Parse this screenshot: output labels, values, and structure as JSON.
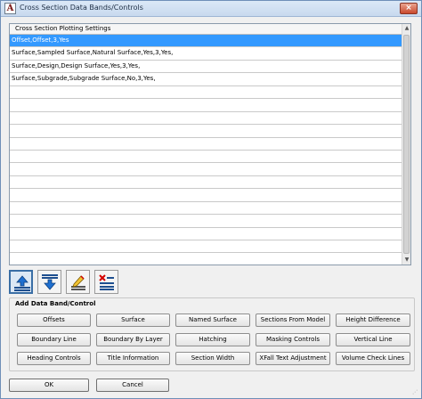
{
  "window": {
    "title": "Cross Section Data Bands/Controls",
    "icon_letter": "A",
    "close_glyph": "×"
  },
  "grid": {
    "header": "Cross Section Plotting Settings",
    "rows": [
      "Offset,Offset,3,Yes",
      "Surface,Sampled Surface,Natural Surface,Yes,3,Yes,",
      "Surface,Design,Design Surface,Yes,3,Yes,",
      "Surface,Subgrade,Subgrade Surface,No,3,Yes,",
      "",
      "",
      "",
      "",
      "",
      "",
      "",
      "",
      "",
      "",
      "",
      "",
      "",
      ""
    ],
    "selected_row": 0,
    "scroll_up": "▲",
    "scroll_down": "▼"
  },
  "toolbar": [
    "move-up-icon",
    "move-down-icon",
    "edit-icon",
    "delete-icon"
  ],
  "add_group": {
    "label": "Add Data Band/Control",
    "buttons": [
      [
        "Offsets",
        "Surface",
        "Named Surface",
        "Sections From Model",
        "Height Difference"
      ],
      [
        "Boundary Line",
        "Boundary By Layer",
        "Hatching",
        "Masking Controls",
        "Vertical Line"
      ],
      [
        "Heading Controls",
        "Title Information",
        "Section Width",
        "XFall Text Adjustment",
        "Volume Check Lines"
      ]
    ]
  },
  "footer": {
    "ok": "OK",
    "cancel": "Cancel"
  },
  "colors": {
    "selection": "#3399ff",
    "title_bar": "#c8d9ee",
    "close": "#c9482d"
  }
}
